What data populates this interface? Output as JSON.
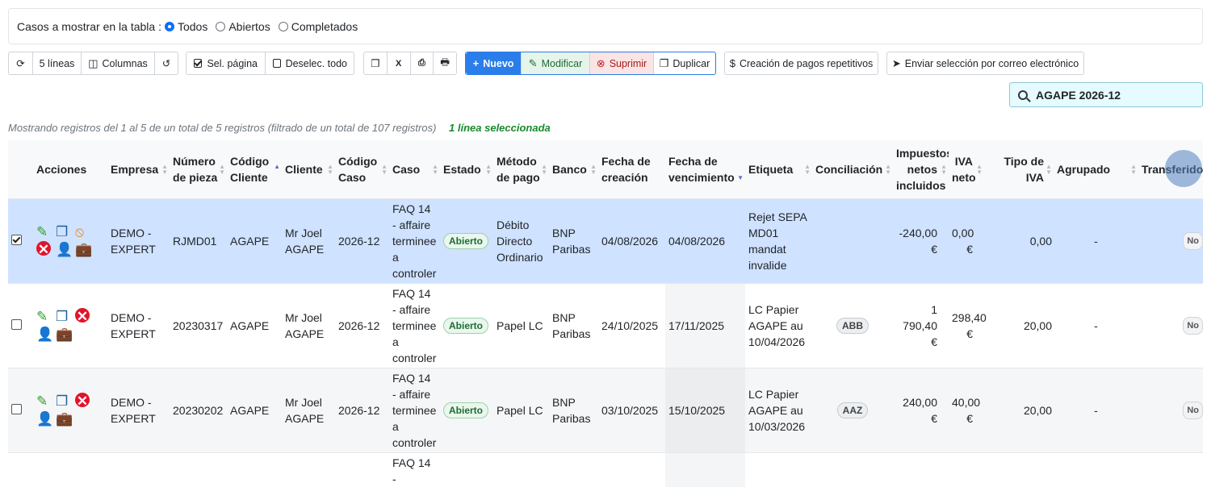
{
  "filter": {
    "label": "Casos a mostrar en la tabla :",
    "options": [
      "Todos",
      "Abiertos",
      "Completados"
    ],
    "selected": "Todos"
  },
  "toolbar": {
    "refresh_icon": "refresh-icon",
    "lines": "5 líneas",
    "columns": "Columnas",
    "undo_icon": "undo-icon",
    "sel_page": "Sel. página",
    "deselect_all": "Deselec. todo",
    "copy_icon": "copy-icon",
    "excel_icon": "excel-icon",
    "pdf_icon": "pdf-icon",
    "print_icon": "print-icon",
    "new": "Nuevo",
    "modify": "Modificar",
    "delete": "Suprimir",
    "duplicate": "Duplicar",
    "repeat_payments": "Creación de pagos repetitivos",
    "send_email": "Enviar selección por correo electrónico"
  },
  "search": {
    "value": "AGAPE 2026-12"
  },
  "info": {
    "text": "Mostrando registros del 1 al 5 de un total de 5 registros (filtrado de un total de 107 registros)",
    "selected": "1 línea seleccionada"
  },
  "table": {
    "headers": {
      "acciones": "Acciones",
      "empresa": "Empresa",
      "numero_pieza": "Número de pieza",
      "codigo_cliente": "Código Cliente",
      "cliente": "Cliente",
      "codigo_caso": "Código Caso",
      "caso": "Caso",
      "estado": "Estado",
      "metodo_pago": "Método de pago",
      "banco": "Banco",
      "fecha_creacion": "Fecha de creación",
      "fecha_vencimiento": "Fecha de vencimiento",
      "etiqueta": "Etiqueta",
      "conciliacion": "Conciliación",
      "impuestos": "Impuestos netos incluidos",
      "iva_neto": "IVA neto",
      "tipo_iva": "Tipo de IVA",
      "agrupado": "Agrupado",
      "transferido": "Transferido a c"
    },
    "rows": [
      {
        "selected": true,
        "empresa": "DEMO - EXPERT",
        "numero_pieza": "RJMD01",
        "codigo_cliente": "AGAPE",
        "cliente": "Mr Joel AGAPE",
        "codigo_caso": "2026-12",
        "caso": "FAQ 14 - affaire terminee a controler",
        "estado": "Abierto",
        "metodo_pago": "Débito Directo Ordinario",
        "banco": "BNP Paribas",
        "fecha_creacion": "04/08/2026",
        "fecha_vencimiento": "04/08/2026",
        "etiqueta": "Rejet SEPA MD01 mandat invalide",
        "conciliacion": "",
        "impuestos": "-240,00 €",
        "iva_neto": "0,00 €",
        "tipo_iva": "0,00",
        "agrupado": "-",
        "transferido": "No"
      },
      {
        "selected": false,
        "empresa": "DEMO - EXPERT",
        "numero_pieza": "20230317",
        "codigo_cliente": "AGAPE",
        "cliente": "Mr Joel AGAPE",
        "codigo_caso": "2026-12",
        "caso": "FAQ 14 - affaire terminee a controler",
        "estado": "Abierto",
        "metodo_pago": "Papel LC",
        "banco": "BNP Paribas",
        "fecha_creacion": "24/10/2025",
        "fecha_vencimiento": "17/11/2025",
        "etiqueta": "LC Papier AGAPE au 10/04/2026",
        "conciliacion": "ABB",
        "impuestos": "1 790,40 €",
        "iva_neto": "298,40 €",
        "tipo_iva": "20,00",
        "agrupado": "-",
        "transferido": "No"
      },
      {
        "selected": false,
        "empresa": "DEMO - EXPERT",
        "numero_pieza": "20230202",
        "codigo_cliente": "AGAPE",
        "cliente": "Mr Joel AGAPE",
        "codigo_caso": "2026-12",
        "caso": "FAQ 14 - affaire terminee a controler",
        "estado": "Abierto",
        "metodo_pago": "Papel LC",
        "banco": "BNP Paribas",
        "fecha_creacion": "03/10/2025",
        "fecha_vencimiento": "15/10/2025",
        "etiqueta": "LC Papier AGAPE au 10/03/2026",
        "conciliacion": "AAZ",
        "impuestos": "240,00 €",
        "iva_neto": "40,00 €",
        "tipo_iva": "20,00",
        "agrupado": "-",
        "transferido": "No"
      },
      {
        "caso": "FAQ 14 -"
      }
    ]
  }
}
